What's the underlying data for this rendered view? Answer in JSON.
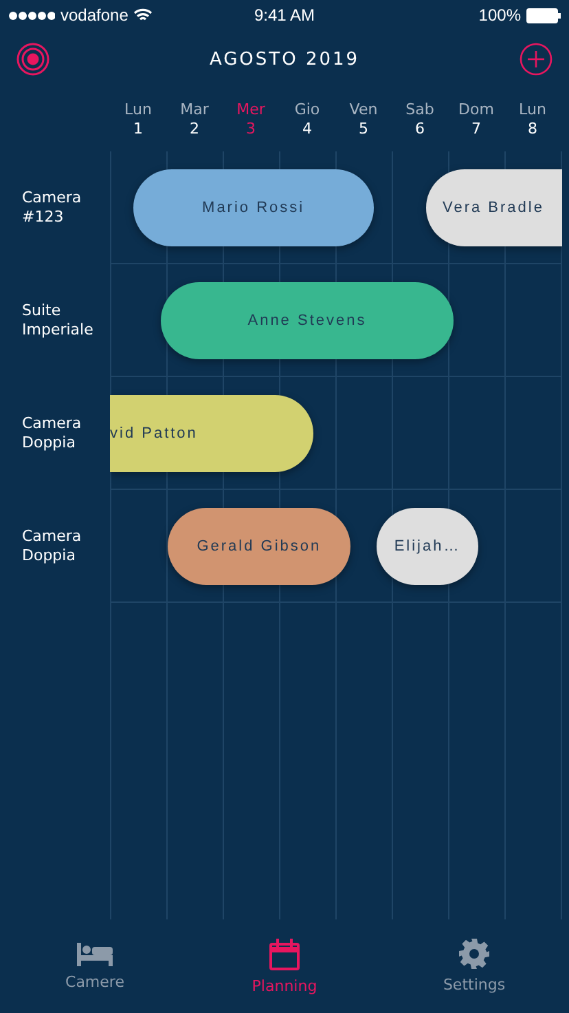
{
  "status_bar": {
    "carrier": "vodafone",
    "time": "9:41 AM",
    "battery": "100%"
  },
  "header": {
    "title": "AGOSTO 2019"
  },
  "days": [
    {
      "name": "Lun",
      "number": "1",
      "selected": false
    },
    {
      "name": "Mar",
      "number": "2",
      "selected": false
    },
    {
      "name": "Mer",
      "number": "3",
      "selected": true
    },
    {
      "name": "Gio",
      "number": "4",
      "selected": false
    },
    {
      "name": "Ven",
      "number": "5",
      "selected": false
    },
    {
      "name": "Sab",
      "number": "6",
      "selected": false
    },
    {
      "name": "Dom",
      "number": "7",
      "selected": false
    },
    {
      "name": "Lun",
      "number": "8",
      "selected": false
    }
  ],
  "rooms": [
    {
      "name": "Camera #123",
      "bookings": [
        {
          "guest": "Mario Rossi",
          "color": "#76acd8"
        },
        {
          "guest": "Vera Bradle",
          "color": "#dedede"
        }
      ]
    },
    {
      "name": "Suite Imperiale",
      "bookings": [
        {
          "guest": "Anne Stevens",
          "color": "#38b78f"
        }
      ]
    },
    {
      "name": "Camera Doppia",
      "bookings": [
        {
          "guest": "vid Patton",
          "color": "#d2d170"
        }
      ]
    },
    {
      "name": "Camera Doppia",
      "bookings": [
        {
          "guest": "Gerald Gibson",
          "color": "#d19470"
        },
        {
          "guest": "Elijah…",
          "color": "#dedede"
        }
      ]
    }
  ],
  "tabs": [
    {
      "label": "Camere",
      "selected": false
    },
    {
      "label": "Planning",
      "selected": true
    },
    {
      "label": "Settings",
      "selected": false
    }
  ]
}
